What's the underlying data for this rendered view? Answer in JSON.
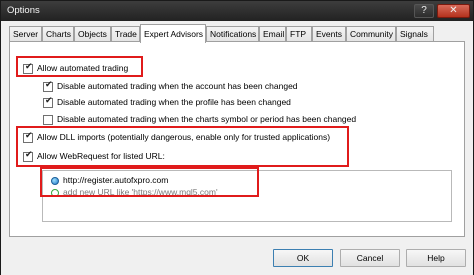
{
  "window": {
    "title": "Options",
    "help_glyph": "?",
    "close_glyph": "✕"
  },
  "tabs": [
    {
      "label": "Server"
    },
    {
      "label": "Charts"
    },
    {
      "label": "Objects"
    },
    {
      "label": "Trade"
    },
    {
      "label": "Expert Advisors",
      "active": true
    },
    {
      "label": "Notifications"
    },
    {
      "label": "Email"
    },
    {
      "label": "FTP"
    },
    {
      "label": "Events"
    },
    {
      "label": "Community"
    },
    {
      "label": "Signals"
    }
  ],
  "options": {
    "allow_automated_trading": {
      "label": "Allow automated trading",
      "checked": true
    },
    "disable_account_changed": {
      "label": "Disable automated trading when the account has been changed",
      "checked": true
    },
    "disable_profile_changed": {
      "label": "Disable automated trading when the profile has been changed",
      "checked": true
    },
    "disable_symbol_changed": {
      "label": "Disable automated trading when the charts symbol or period has been changed",
      "checked": false
    },
    "allow_dll_imports": {
      "label": "Allow DLL imports (potentially dangerous, enable only for trusted applications)",
      "checked": true
    },
    "allow_webrequest": {
      "label": "Allow WebRequest for listed URL:",
      "checked": true
    }
  },
  "url_list": {
    "items": [
      "http://register.autofxpro.com"
    ],
    "add_placeholder": "add new URL like 'https://www.mql5.com'"
  },
  "buttons": {
    "ok": "OK",
    "cancel": "Cancel",
    "help": "Help"
  },
  "colors": {
    "highlight": "#e01b1b",
    "titlebar": "#2b2b2b",
    "close": "#c44a37"
  }
}
